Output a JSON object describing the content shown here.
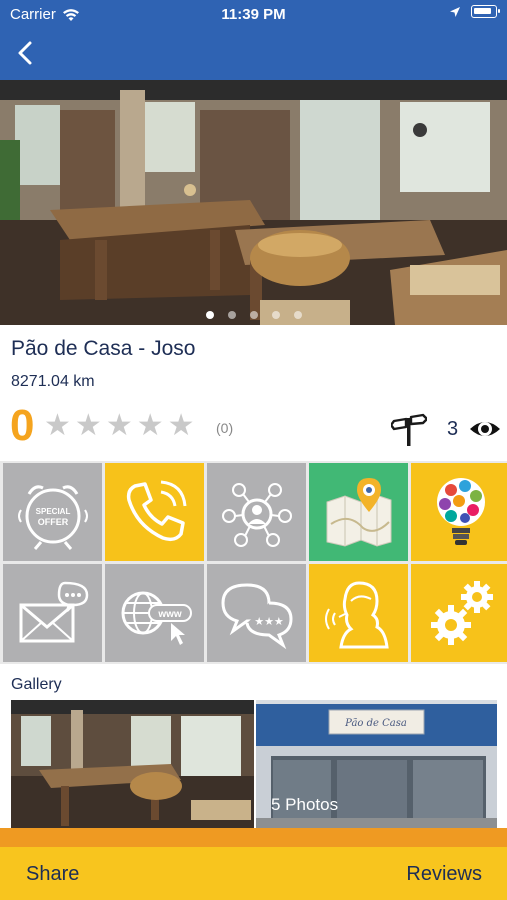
{
  "status_bar": {
    "carrier": "Carrier",
    "time": "11:39 PM"
  },
  "place": {
    "name": "Pão de Casa - Joso",
    "distance": "8271.04 km",
    "rating": "0",
    "stars_filled": 0,
    "stars_total": 5,
    "rating_count": "(0)",
    "views": "3"
  },
  "hero": {
    "photo_index": 1,
    "photo_total": 5
  },
  "tiles": [
    {
      "name": "special-offer",
      "icon": "alarm-clock-special-offer-icon",
      "color": "#b0b0b2"
    },
    {
      "name": "call",
      "icon": "phone-icon",
      "color": "#f7c21a"
    },
    {
      "name": "social",
      "icon": "social-network-icon",
      "color": "#b0b0b2"
    },
    {
      "name": "map",
      "icon": "map-pin-icon",
      "color": "#41b875"
    },
    {
      "name": "ideas",
      "icon": "lightbulb-apps-icon",
      "color": "#f7c21a"
    },
    {
      "name": "email",
      "icon": "envelope-icon",
      "color": "#b0b0b2"
    },
    {
      "name": "website",
      "icon": "globe-www-icon",
      "color": "#b0b0b2"
    },
    {
      "name": "chat",
      "icon": "chat-bubbles-icon",
      "color": "#b0b0b2"
    },
    {
      "name": "contact",
      "icon": "operator-icon",
      "color": "#f7c21a"
    },
    {
      "name": "settings",
      "icon": "gears-icon",
      "color": "#f7c21a"
    }
  ],
  "gallery": {
    "label": "Gallery",
    "photo_count": "5 Photos",
    "shop_sign": "Pão de Casa"
  },
  "footer": {
    "share": "Share",
    "reviews": "Reviews"
  },
  "colors": {
    "header": "#2f63b3",
    "accent_orange": "#f5a41e",
    "footer": "#f8c51e",
    "text_navy": "#1e2e55"
  }
}
